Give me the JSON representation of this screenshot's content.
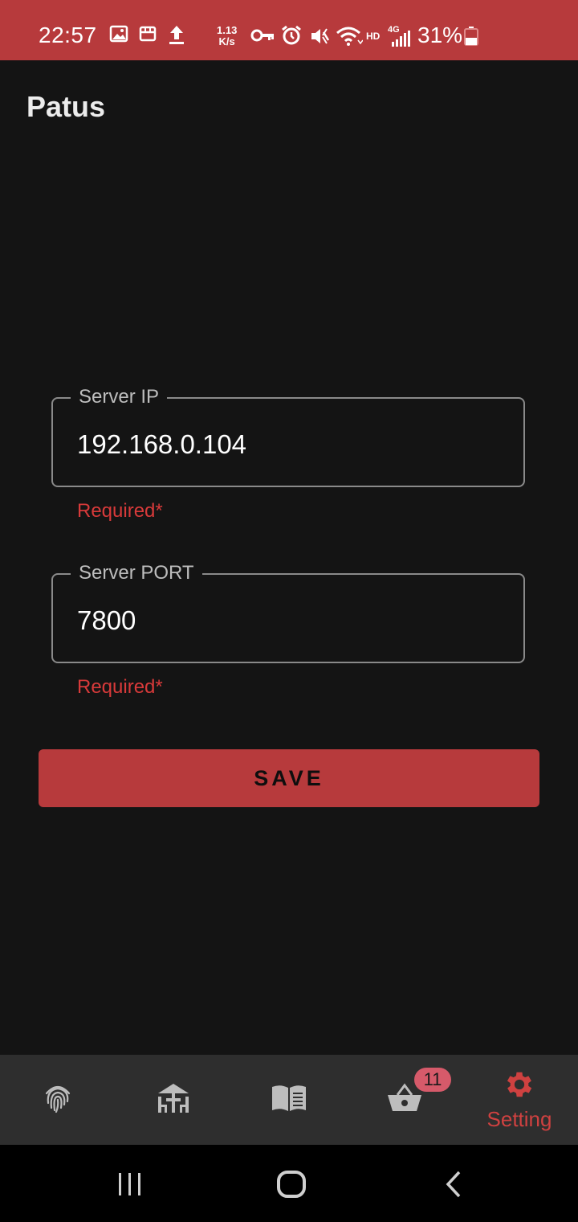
{
  "status_bar": {
    "time": "22:57",
    "speed_value": "1.13",
    "speed_unit": "K/s",
    "hd": "HD",
    "network": "4G",
    "battery": "31%",
    "icons": [
      "image-icon",
      "store-icon",
      "upload-icon",
      "key-icon",
      "alarm-icon",
      "mute-icon",
      "wifi-icon",
      "signal-icon",
      "battery-icon"
    ]
  },
  "app": {
    "title": "Patus"
  },
  "form": {
    "server_ip": {
      "label": "Server IP",
      "value": "192.168.0.104",
      "helper": "Required*"
    },
    "server_port": {
      "label": "Server PORT",
      "value": "7800",
      "helper": "Required*"
    },
    "save_label": "SAVE"
  },
  "bottom_nav": {
    "items": [
      {
        "icon": "fingerprint-icon",
        "label": ""
      },
      {
        "icon": "table-dining-icon",
        "label": ""
      },
      {
        "icon": "menu-book-icon",
        "label": ""
      },
      {
        "icon": "basket-icon",
        "label": "",
        "badge": "11"
      },
      {
        "icon": "gear-icon",
        "label": "Setting",
        "active": true
      }
    ]
  },
  "colors": {
    "accent": "#b73a3c",
    "background": "#141414",
    "error": "#d83a3a",
    "nav_bg": "#2e2e2e"
  }
}
